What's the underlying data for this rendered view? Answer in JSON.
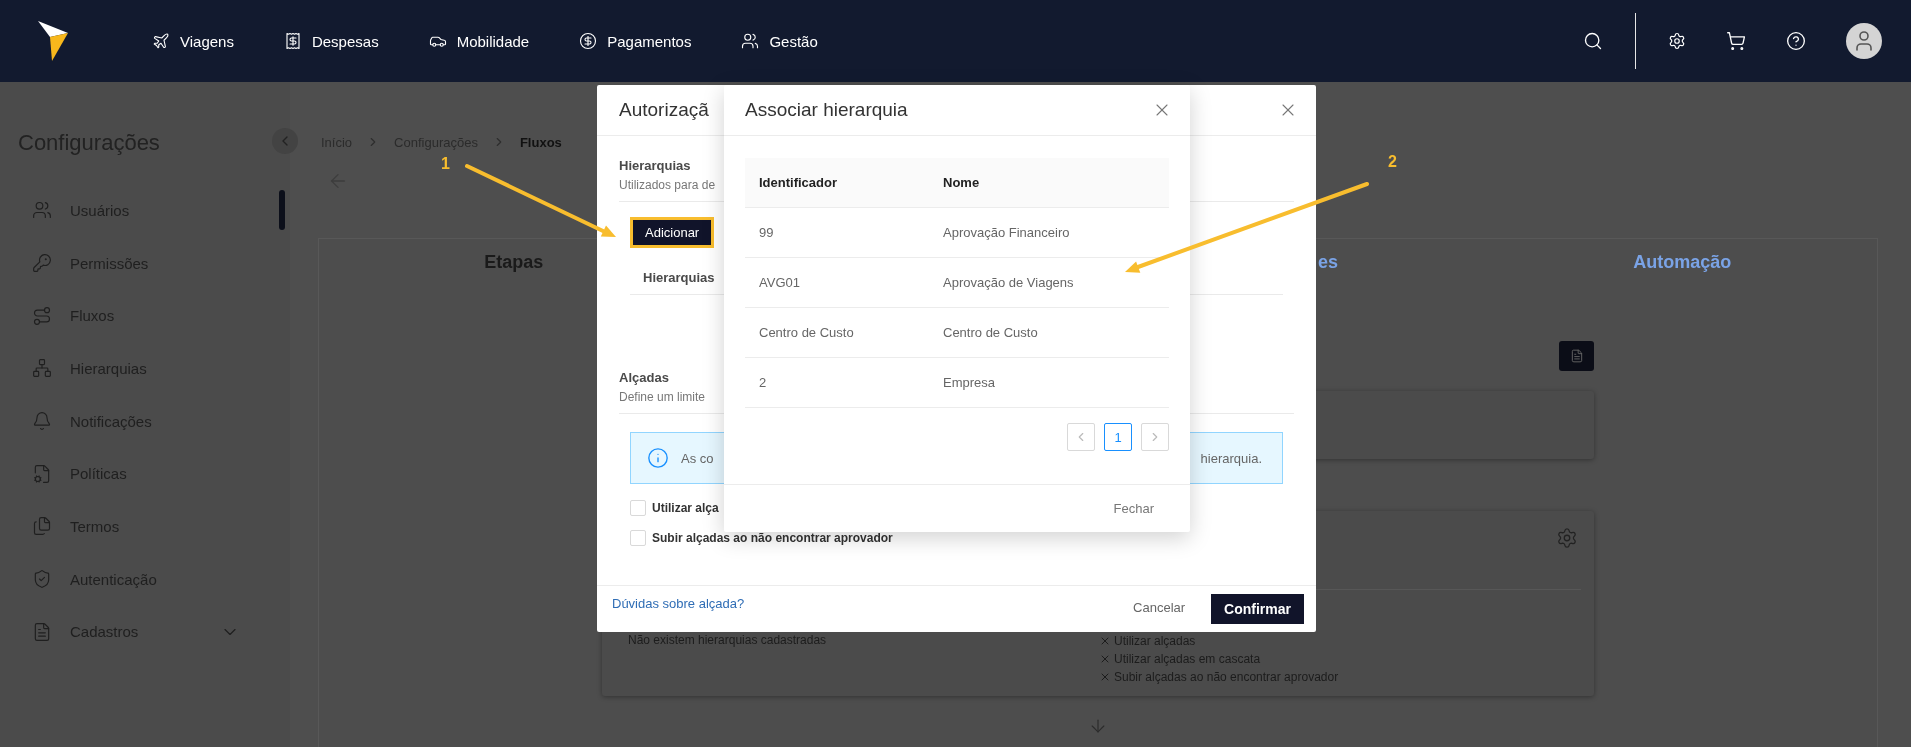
{
  "topbar": {
    "nav": [
      {
        "label": "Viagens"
      },
      {
        "label": "Despesas"
      },
      {
        "label": "Mobilidade"
      },
      {
        "label": "Pagamentos"
      },
      {
        "label": "Gestão"
      }
    ]
  },
  "sidebar": {
    "title": "Configurações",
    "items": [
      {
        "label": "Usuários"
      },
      {
        "label": "Permissões"
      },
      {
        "label": "Fluxos"
      },
      {
        "label": "Hierarquias"
      },
      {
        "label": "Notificações"
      },
      {
        "label": "Políticas"
      },
      {
        "label": "Termos"
      },
      {
        "label": "Autenticação"
      },
      {
        "label": "Cadastros",
        "expanded": false
      }
    ]
  },
  "breadcrumb": [
    {
      "label": "Início",
      "current": false
    },
    {
      "label": "Configurações",
      "current": false
    },
    {
      "label": "Fluxos",
      "current": true
    }
  ],
  "tabs": [
    {
      "label": "Etapas",
      "selected": true
    },
    {
      "label": "es",
      "selected": false
    },
    {
      "label": "Automação",
      "selected": false
    }
  ],
  "stage_card": {
    "empty_text": "Não existem hierarquias cadastradas",
    "options": [
      {
        "label": "Utilizar alçadas",
        "enabled": false
      },
      {
        "label": "Utilizar alçadas em cascata",
        "enabled": false
      },
      {
        "label": "Subir alçadas ao não encontrar aprovador",
        "enabled": false
      }
    ]
  },
  "authorization_dialog": {
    "title": "Autorizaçã",
    "hierarchies": {
      "title": "Hierarquias",
      "description": "Utilizados para de",
      "add_button": "Adicionar",
      "column_1": "Hierarquias"
    },
    "thresholds": {
      "title": "Alçadas",
      "description": "Define um limite",
      "info_left": "As co",
      "info_right": "hierarquia.",
      "options": [
        {
          "label": "Utilizar alça",
          "checked": false
        },
        {
          "label": "Subir alçadas ao não encontrar aprovador",
          "checked": false
        }
      ]
    },
    "help_link": "Dúvidas sobre alçada?",
    "cancel": "Cancelar",
    "confirm": "Confirmar"
  },
  "associate_dialog": {
    "title": "Associar hierarquia",
    "columns": [
      "Identificador",
      "Nome"
    ],
    "rows": [
      [
        "99",
        "Aprovação Financeiro"
      ],
      [
        "AVG01",
        "Aprovação de Viagens"
      ],
      [
        "Centro de Custo",
        "Centro de Custo"
      ],
      [
        "2",
        "Empresa"
      ]
    ],
    "pages": [
      {
        "label": "1",
        "selected": true
      }
    ],
    "close_button": "Fechar"
  },
  "annotations": [
    {
      "label": "1"
    },
    {
      "label": "2"
    }
  ]
}
